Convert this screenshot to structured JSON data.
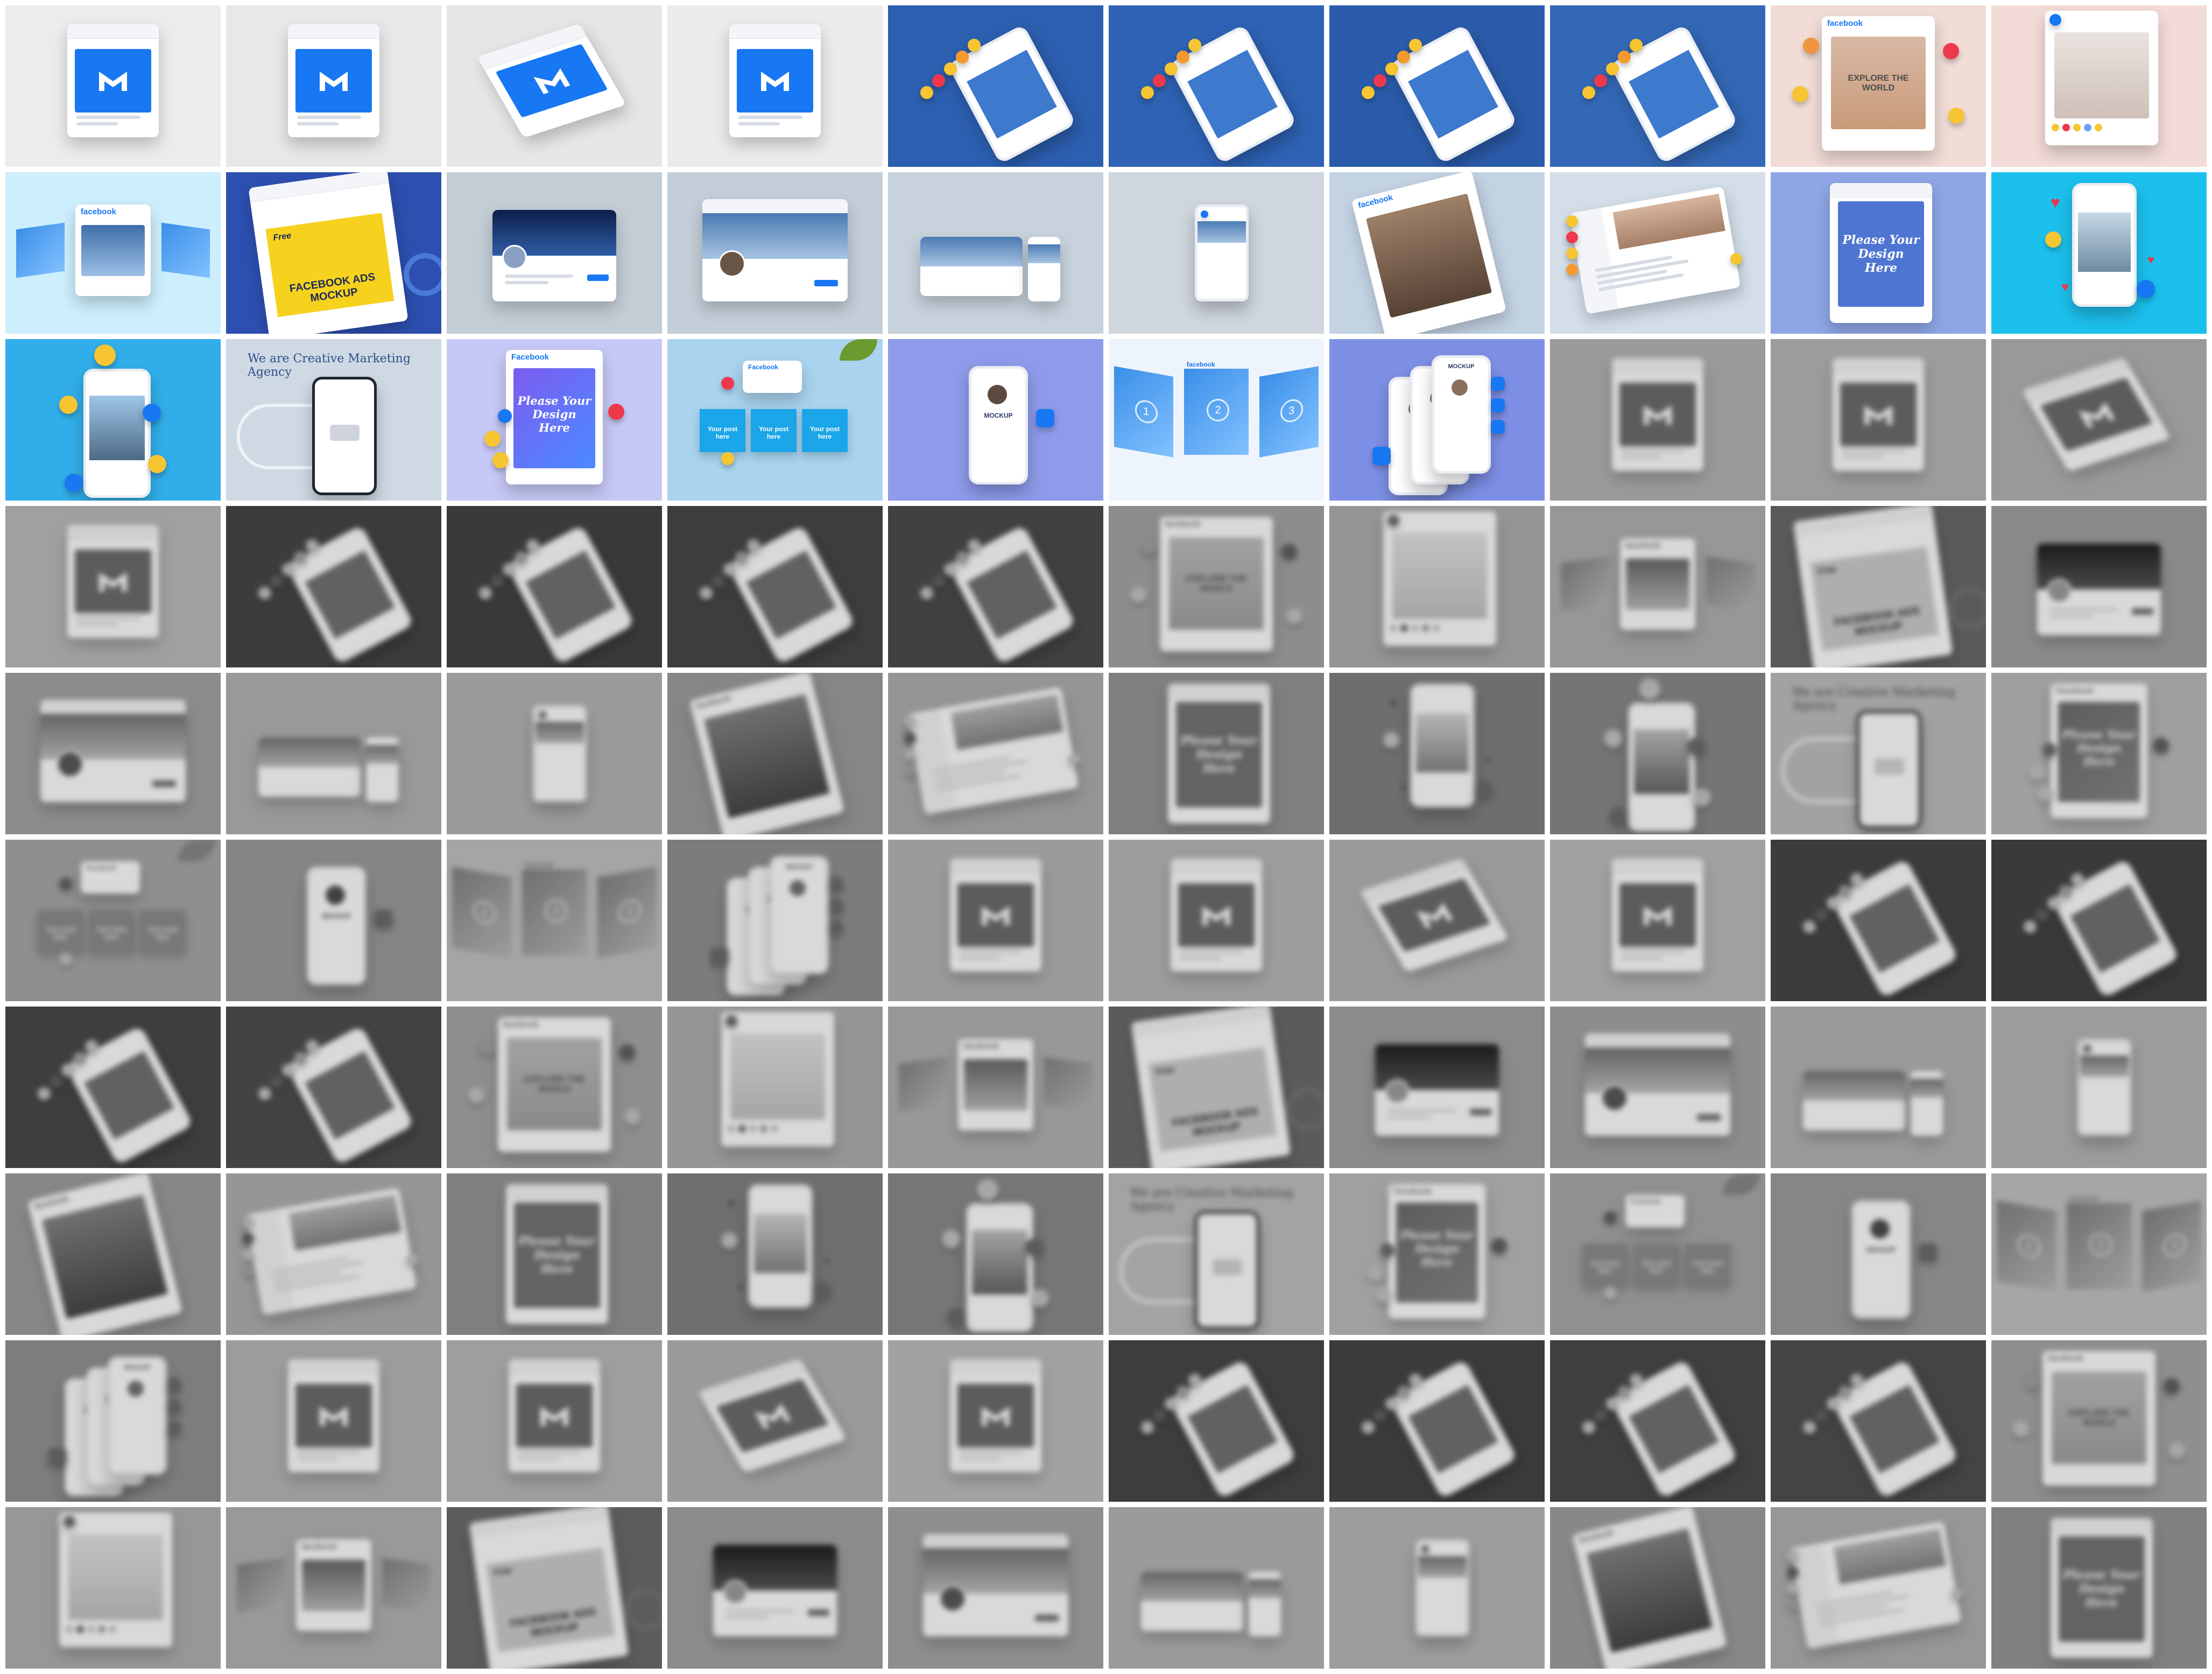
{
  "gallery": {
    "rows": 10,
    "columns": 10,
    "tiles": [
      {
        "style": "fbpost-light",
        "bg": "#ececec",
        "dim": false
      },
      {
        "style": "fbpost-light",
        "bg": "#e8e8e8",
        "dim": false
      },
      {
        "style": "fbpost-tilt",
        "bg": "#e6e6e6",
        "dim": false
      },
      {
        "style": "fbpost-light",
        "bg": "#ebebeb",
        "dim": false
      },
      {
        "style": "phone-tilt-blue",
        "bg": "#2c5fb0",
        "dim": false
      },
      {
        "style": "phone-tilt-blue",
        "bg": "#2e62b4",
        "dim": false
      },
      {
        "style": "phone-tilt-blue",
        "bg": "#2b5cab",
        "dim": false
      },
      {
        "style": "phone-tilt-blue",
        "bg": "#3368b6",
        "dim": false
      },
      {
        "style": "explore-world",
        "bg": "#f1dcd6",
        "dim": false,
        "brand": "facebook",
        "headline": "EXPLORE THE WORLD"
      },
      {
        "style": "portrait-post",
        "bg": "#f3dcd8",
        "dim": false
      },
      {
        "style": "three-panels",
        "bg": "#cdeefc",
        "dim": false,
        "brand": "facebook"
      },
      {
        "style": "ads-mockup",
        "bg": "#2d4fb0",
        "dim": false,
        "headline": "FACEBOOK ADS MOCKUP",
        "tag": "Free"
      },
      {
        "style": "cover-night",
        "bg": "#c3cdd6",
        "dim": false
      },
      {
        "style": "cover-city",
        "bg": "#c4ced8",
        "dim": false
      },
      {
        "style": "cover-small",
        "bg": "#c7d2dc",
        "dim": false
      },
      {
        "style": "phone-small",
        "bg": "#cfd6de",
        "dim": false
      },
      {
        "style": "fb-person",
        "bg": "#c3d3e4",
        "dim": false,
        "brand": "facebook"
      },
      {
        "style": "profile-desk",
        "bg": "#d3dee9",
        "dim": false
      },
      {
        "style": "design-here",
        "bg": "#8ea6e6",
        "dim": false,
        "headline": "Please Your Design Here"
      },
      {
        "style": "phone-hearts",
        "bg": "#1cc0ec",
        "dim": false
      },
      {
        "style": "phone-emoji",
        "bg": "#31aee9",
        "dim": false
      },
      {
        "style": "agency-phone",
        "bg": "#cfd9e4",
        "dim": false,
        "headline": "We are Creative Marketing Agency"
      },
      {
        "style": "design-here-purple",
        "bg": "#c6c8f6",
        "dim": false,
        "brand": "Facebook",
        "headline": "Please Your Design Here"
      },
      {
        "style": "three-posts",
        "bg": "#a9d3ef",
        "dim": false,
        "brand": "Facebook",
        "labels": [
          "Your post here",
          "Your post here",
          "Your post here"
        ]
      },
      {
        "style": "phone-profile",
        "bg": "#8d9bea",
        "dim": false,
        "headline": "MOCKUP"
      },
      {
        "style": "numbered-panels",
        "bg": "#eef4fb",
        "dim": false,
        "brand": "facebook",
        "numbers": [
          "1",
          "2",
          "3"
        ]
      },
      {
        "style": "multi-phones",
        "bg": "#7e90e6",
        "dim": false,
        "headline": "MOCKUP"
      },
      {
        "style": "fbpost-light",
        "bg": "#9a9a9a",
        "dim": true
      },
      {
        "style": "fbpost-light",
        "bg": "#9c9c9c",
        "dim": true
      },
      {
        "style": "fbpost-tilt",
        "bg": "#999999",
        "dim": true
      },
      {
        "style": "fbpost-light",
        "bg": "#a0a0a0",
        "dim": true
      },
      {
        "style": "phone-tilt-blue",
        "bg": "#3c3c3c",
        "dim": true
      },
      {
        "style": "phone-tilt-blue",
        "bg": "#3a3a3a",
        "dim": true
      },
      {
        "style": "phone-tilt-blue",
        "bg": "#3d3d3d",
        "dim": true
      },
      {
        "style": "phone-tilt-blue",
        "bg": "#414141",
        "dim": true
      },
      {
        "style": "explore-world",
        "bg": "#8d8d8d",
        "dim": true,
        "brand": "facebook",
        "headline": "EXPLORE THE WORLD"
      },
      {
        "style": "portrait-post",
        "bg": "#959595",
        "dim": true
      },
      {
        "style": "three-panels",
        "bg": "#979797",
        "dim": true,
        "brand": "facebook"
      },
      {
        "style": "ads-mockup",
        "bg": "#5a5a5a",
        "dim": true,
        "headline": "FACEBOOK ADS MOCKUP",
        "tag": "Free"
      },
      {
        "style": "cover-night",
        "bg": "#8a8a8a",
        "dim": true
      },
      {
        "style": "cover-city",
        "bg": "#8c8c8c",
        "dim": true
      },
      {
        "style": "cover-small",
        "bg": "#999999",
        "dim": true
      },
      {
        "style": "phone-small",
        "bg": "#9b9b9b",
        "dim": true
      },
      {
        "style": "fb-person",
        "bg": "#868686",
        "dim": true,
        "brand": "facebook"
      },
      {
        "style": "profile-desk",
        "bg": "#959595",
        "dim": true
      },
      {
        "style": "design-here",
        "bg": "#7f7f7f",
        "dim": true,
        "headline": "Please Your Design Here"
      },
      {
        "style": "phone-hearts",
        "bg": "#6e6e6e",
        "dim": true
      },
      {
        "style": "phone-emoji",
        "bg": "#757575",
        "dim": true
      },
      {
        "style": "agency-phone",
        "bg": "#a2a2a2",
        "dim": true,
        "headline": "We are Creative Marketing Agency"
      },
      {
        "style": "design-here-purple",
        "bg": "#9f9f9f",
        "dim": true,
        "brand": "Facebook",
        "headline": "Please Your Design Here"
      },
      {
        "style": "three-posts",
        "bg": "#8f8f8f",
        "dim": true,
        "brand": "Facebook",
        "labels": [
          "Your post here",
          "Your post here",
          "Your post here"
        ]
      },
      {
        "style": "phone-profile",
        "bg": "#858585",
        "dim": true,
        "headline": "MOCKUP"
      },
      {
        "style": "numbered-panels",
        "bg": "#a5a5a5",
        "dim": true,
        "brand": "facebook",
        "numbers": [
          "1",
          "2",
          "3"
        ]
      },
      {
        "style": "multi-phones",
        "bg": "#7c7c7c",
        "dim": true,
        "headline": "MOCKUP"
      },
      {
        "style": "fbpost-light",
        "bg": "#9b9b9b",
        "dim": true
      },
      {
        "style": "fbpost-light",
        "bg": "#9d9d9d",
        "dim": true
      },
      {
        "style": "fbpost-tilt",
        "bg": "#9a9a9a",
        "dim": true
      },
      {
        "style": "fbpost-light",
        "bg": "#a1a1a1",
        "dim": true
      },
      {
        "style": "phone-tilt-blue",
        "bg": "#3c3c3c",
        "dim": true
      },
      {
        "style": "phone-tilt-blue",
        "bg": "#3a3a3a",
        "dim": true
      },
      {
        "style": "phone-tilt-blue",
        "bg": "#3e3e3e",
        "dim": true
      },
      {
        "style": "phone-tilt-blue",
        "bg": "#434343",
        "dim": true
      },
      {
        "style": "explore-world",
        "bg": "#8e8e8e",
        "dim": true,
        "brand": "facebook",
        "headline": "EXPLORE THE WORLD"
      },
      {
        "style": "portrait-post",
        "bg": "#969696",
        "dim": true
      },
      {
        "style": "three-panels",
        "bg": "#989898",
        "dim": true,
        "brand": "facebook"
      },
      {
        "style": "ads-mockup",
        "bg": "#5b5b5b",
        "dim": true,
        "headline": "FACEBOOK ADS MOCKUP",
        "tag": "Free"
      },
      {
        "style": "cover-night",
        "bg": "#8b8b8b",
        "dim": true
      },
      {
        "style": "cover-city",
        "bg": "#8d8d8d",
        "dim": true
      },
      {
        "style": "cover-small",
        "bg": "#9a9a9a",
        "dim": true
      },
      {
        "style": "phone-small",
        "bg": "#9c9c9c",
        "dim": true
      },
      {
        "style": "fb-person",
        "bg": "#878787",
        "dim": true,
        "brand": "facebook"
      },
      {
        "style": "profile-desk",
        "bg": "#969696",
        "dim": true
      },
      {
        "style": "design-here",
        "bg": "#808080",
        "dim": true,
        "headline": "Please Your Design Here"
      },
      {
        "style": "phone-hearts",
        "bg": "#6f6f6f",
        "dim": true
      },
      {
        "style": "phone-emoji",
        "bg": "#767676",
        "dim": true
      },
      {
        "style": "agency-phone",
        "bg": "#a3a3a3",
        "dim": true,
        "headline": "We are Creative Marketing Agency"
      },
      {
        "style": "design-here-purple",
        "bg": "#a0a0a0",
        "dim": true,
        "brand": "Facebook",
        "headline": "Please Your Design Here"
      },
      {
        "style": "three-posts",
        "bg": "#909090",
        "dim": true,
        "brand": "Facebook",
        "labels": [
          "Your post here",
          "Your post here",
          "Your post here"
        ]
      },
      {
        "style": "phone-profile",
        "bg": "#868686",
        "dim": true,
        "headline": "MOCKUP"
      },
      {
        "style": "numbered-panels",
        "bg": "#a6a6a6",
        "dim": true,
        "brand": "facebook",
        "numbers": [
          "1",
          "2",
          "3"
        ]
      },
      {
        "style": "multi-phones",
        "bg": "#7d7d7d",
        "dim": true,
        "headline": "MOCKUP"
      },
      {
        "style": "fbpost-light",
        "bg": "#9c9c9c",
        "dim": true
      },
      {
        "style": "fbpost-light",
        "bg": "#9e9e9e",
        "dim": true
      },
      {
        "style": "fbpost-tilt",
        "bg": "#9b9b9b",
        "dim": true
      },
      {
        "style": "fbpost-light",
        "bg": "#a2a2a2",
        "dim": true
      },
      {
        "style": "phone-tilt-blue",
        "bg": "#3d3d3d",
        "dim": true
      },
      {
        "style": "phone-tilt-blue",
        "bg": "#3b3b3b",
        "dim": true
      },
      {
        "style": "phone-tilt-blue",
        "bg": "#3f3f3f",
        "dim": true
      },
      {
        "style": "phone-tilt-blue",
        "bg": "#444444",
        "dim": true
      },
      {
        "style": "explore-world",
        "bg": "#8f8f8f",
        "dim": true,
        "brand": "facebook",
        "headline": "EXPLORE THE WORLD"
      },
      {
        "style": "portrait-post",
        "bg": "#979797",
        "dim": true
      },
      {
        "style": "three-panels",
        "bg": "#999999",
        "dim": true,
        "brand": "facebook"
      },
      {
        "style": "ads-mockup",
        "bg": "#5c5c5c",
        "dim": true,
        "headline": "FACEBOOK ADS MOCKUP",
        "tag": "Free"
      },
      {
        "style": "cover-night",
        "bg": "#8c8c8c",
        "dim": true
      },
      {
        "style": "cover-city",
        "bg": "#8e8e8e",
        "dim": true
      },
      {
        "style": "cover-small",
        "bg": "#9b9b9b",
        "dim": true
      },
      {
        "style": "phone-small",
        "bg": "#9d9d9d",
        "dim": true
      },
      {
        "style": "fb-person",
        "bg": "#888888",
        "dim": true,
        "brand": "facebook"
      },
      {
        "style": "profile-desk",
        "bg": "#979797",
        "dim": true
      },
      {
        "style": "design-here",
        "bg": "#818181",
        "dim": true,
        "headline": "Please Your Design Here"
      }
    ]
  },
  "colors": {
    "facebook_blue": "#1877f2",
    "reaction_yellow": "#f7c531",
    "reaction_red": "#f0384d"
  }
}
